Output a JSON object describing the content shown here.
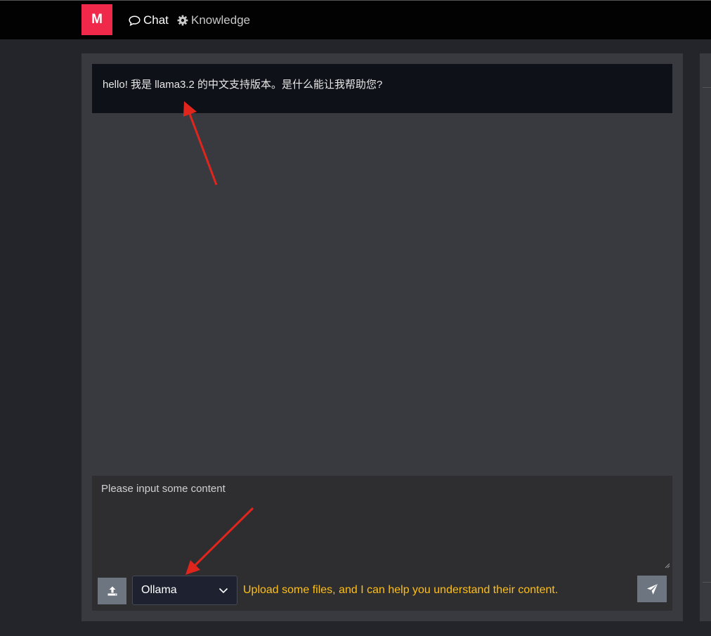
{
  "app": {
    "logo_letter": "M",
    "brand_color": "#f0284a"
  },
  "nav": {
    "chat_label": "Chat",
    "knowledge_label": "Knowledge"
  },
  "chat": {
    "messages": [
      {
        "role": "assistant",
        "text": "hello! 我是 llama3.2 的中文支持版本。是什么能让我帮助您?"
      }
    ]
  },
  "composer": {
    "placeholder": "Please input some content",
    "value": "",
    "model_selected": "Ollama",
    "hint": "Upload some files, and I can help you understand their content.",
    "hint_color": "#ffbf1a"
  },
  "icons": {
    "chat": "speech-bubble-icon",
    "knowledge": "gear-icon",
    "upload": "upload-icon",
    "dropdown": "chevron-down-icon",
    "send": "paper-plane-icon"
  },
  "annotations": {
    "arrow_color": "#e0251d"
  }
}
